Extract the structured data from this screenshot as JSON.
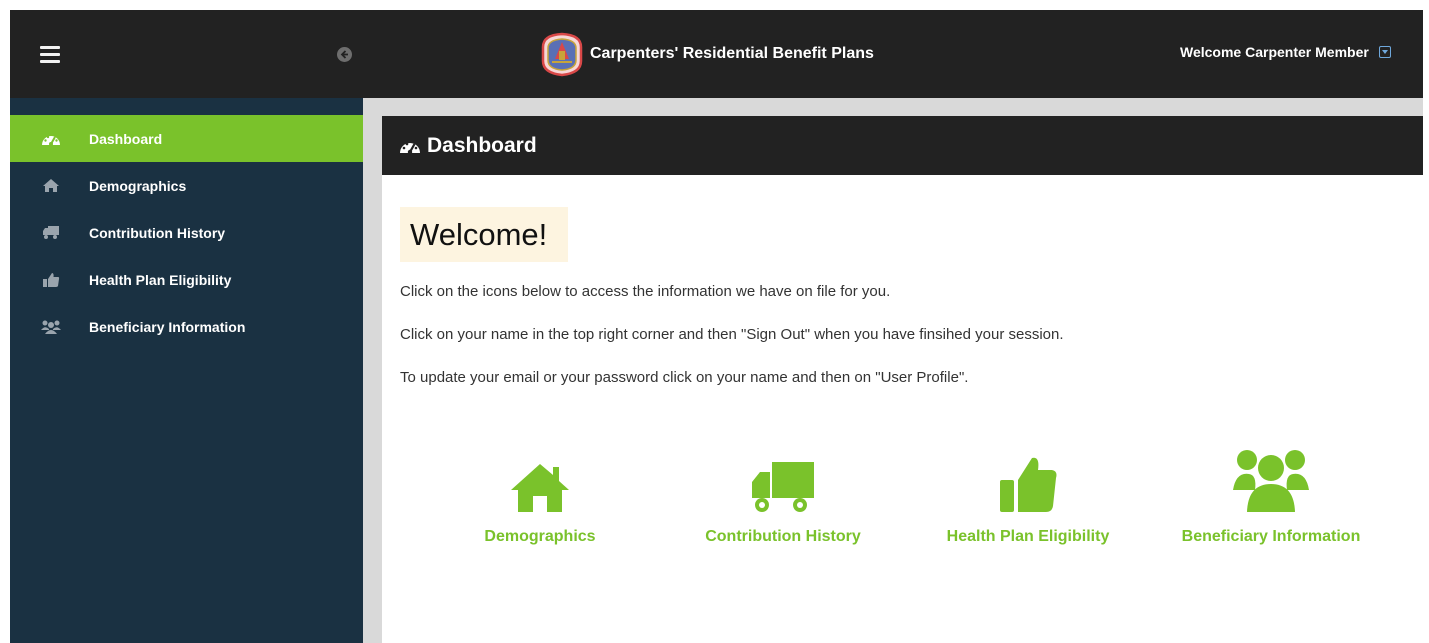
{
  "header": {
    "brand_title": "Carpenters' Residential Benefit Plans",
    "welcome_user": "Welcome Carpenter Member"
  },
  "sidebar": {
    "items": [
      {
        "label": "Dashboard",
        "icon": "dashboard-gauge-icon",
        "active": true
      },
      {
        "label": "Demographics",
        "icon": "home-icon",
        "active": false
      },
      {
        "label": "Contribution History",
        "icon": "truck-icon",
        "active": false
      },
      {
        "label": "Health Plan Eligibility",
        "icon": "thumbs-up-icon",
        "active": false
      },
      {
        "label": "Beneficiary Information",
        "icon": "users-icon",
        "active": false
      }
    ]
  },
  "main": {
    "panel_title": "Dashboard",
    "welcome_title": "Welcome!",
    "lines": [
      "Click on the icons below to access the information we have on file for you.",
      "Click on your name in the top right corner and then \"Sign Out\" when you have finsihed your session.",
      "To update your email or your password click on your name and then on \"User Profile\"."
    ],
    "tiles": [
      {
        "label": "Demographics",
        "icon": "home-icon"
      },
      {
        "label": "Contribution History",
        "icon": "truck-icon"
      },
      {
        "label": "Health Plan Eligibility",
        "icon": "thumbs-up-icon"
      },
      {
        "label": "Beneficiary Information",
        "icon": "users-icon"
      }
    ]
  },
  "colors": {
    "accent_green": "#7ac22b",
    "sidebar_bg": "#1a3142",
    "topbar_bg": "#222222",
    "welcome_bg": "#fdf4e0"
  }
}
